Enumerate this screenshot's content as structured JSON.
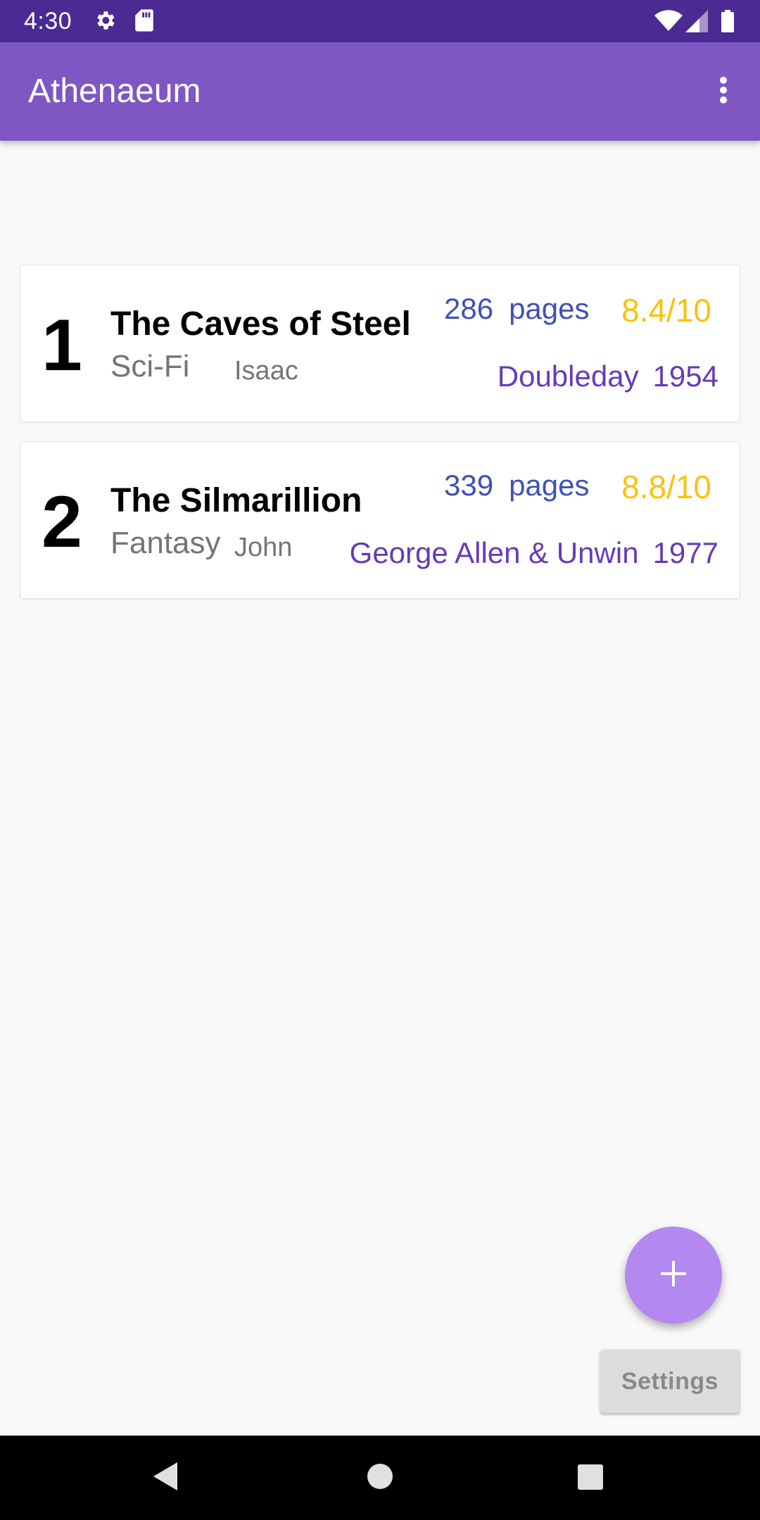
{
  "status_bar": {
    "time": "4:30",
    "left_icons": [
      "gear-icon",
      "sd-card-icon"
    ],
    "right_icons": [
      "wifi-icon",
      "signal-icon",
      "battery-icon"
    ]
  },
  "app_bar": {
    "title": "Athenaeum",
    "menu_icon": "more-vert-icon"
  },
  "books": [
    {
      "rank": "1",
      "title": "The Caves of Steel",
      "genre": "Sci-Fi",
      "author": "Isaac",
      "pages_count": "286",
      "pages_label": "pages",
      "rating": "8.4/10",
      "publisher": "Doubleday",
      "year": "1954"
    },
    {
      "rank": "2",
      "title": "The Silmarillion",
      "genre": "Fantasy",
      "author": "John",
      "pages_count": "339",
      "pages_label": "pages",
      "rating": "8.8/10",
      "publisher": "George Allen & Unwin",
      "year": "1977"
    }
  ],
  "fab": {
    "icon": "plus-icon"
  },
  "settings_button": {
    "label": "Settings"
  },
  "nav_bar": {
    "icons": [
      "back-icon",
      "home-icon",
      "recents-icon"
    ]
  },
  "colors": {
    "status_bar": "#4b2a93",
    "app_bar": "#7e57c2",
    "pages": "#3f51b5",
    "rating": "#ffc107",
    "publisher": "#673ab7",
    "fab": "#b388f0"
  }
}
